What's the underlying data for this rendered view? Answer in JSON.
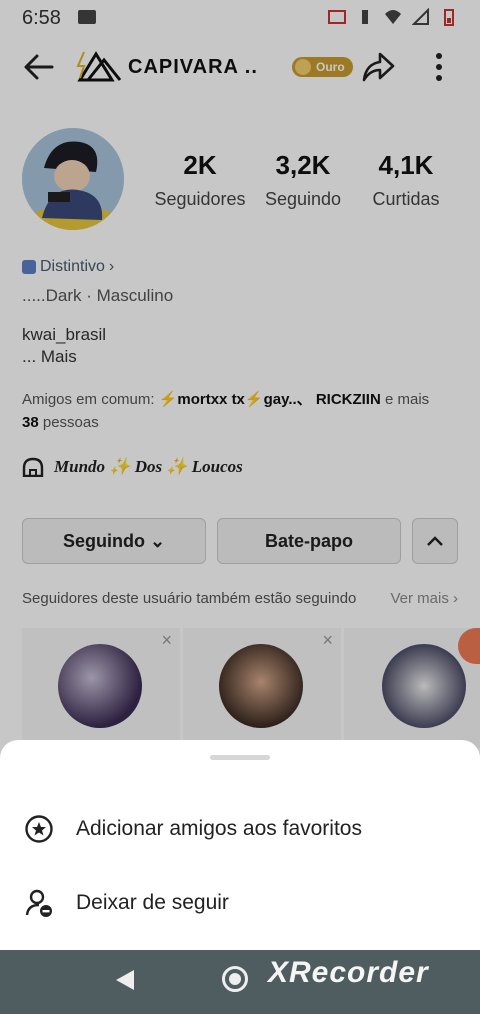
{
  "status_bar": {
    "time": "6:58"
  },
  "header": {
    "username": "CAPIVARA ..",
    "logo_glyph": "⚡⧋ ̶",
    "badge": "Ouro"
  },
  "stats": [
    {
      "value": "2K",
      "label": "Seguidores"
    },
    {
      "value": "3,2K",
      "label": "Seguindo"
    },
    {
      "value": "4,1K",
      "label": "Curtidas"
    }
  ],
  "profile": {
    "distintivo": "Distintivo",
    "chevron": "›",
    "info": ".....Dark · Masculino",
    "bio": "kwai_brasil",
    "bio_more": "...  Mais",
    "mutual_prefix": "Amigos em comum: ",
    "mutual_names": "⚡mortxx tx⚡gay..、 RICKZIIN",
    "mutual_suffix": " e mais ",
    "mutual_count": "38",
    "mutual_people": " pessoas",
    "group": "Mundo ✨ Dos ✨ Loucos"
  },
  "actions": {
    "following": "Seguindo ⌄",
    "chat": "Bate-papo"
  },
  "suggestions": {
    "title": "Seguidores deste usuário também estão seguindo",
    "see_more": "Ver mais ›",
    "close": "×"
  },
  "sheet": {
    "options": [
      "Adicionar amigos aos favoritos",
      "Deixar de seguir"
    ]
  },
  "watermark": "XRecorder",
  "colors": {
    "gold": "#c99b2f",
    "nav": "#4f5c60",
    "badge_blue": "#5b7fc4"
  }
}
